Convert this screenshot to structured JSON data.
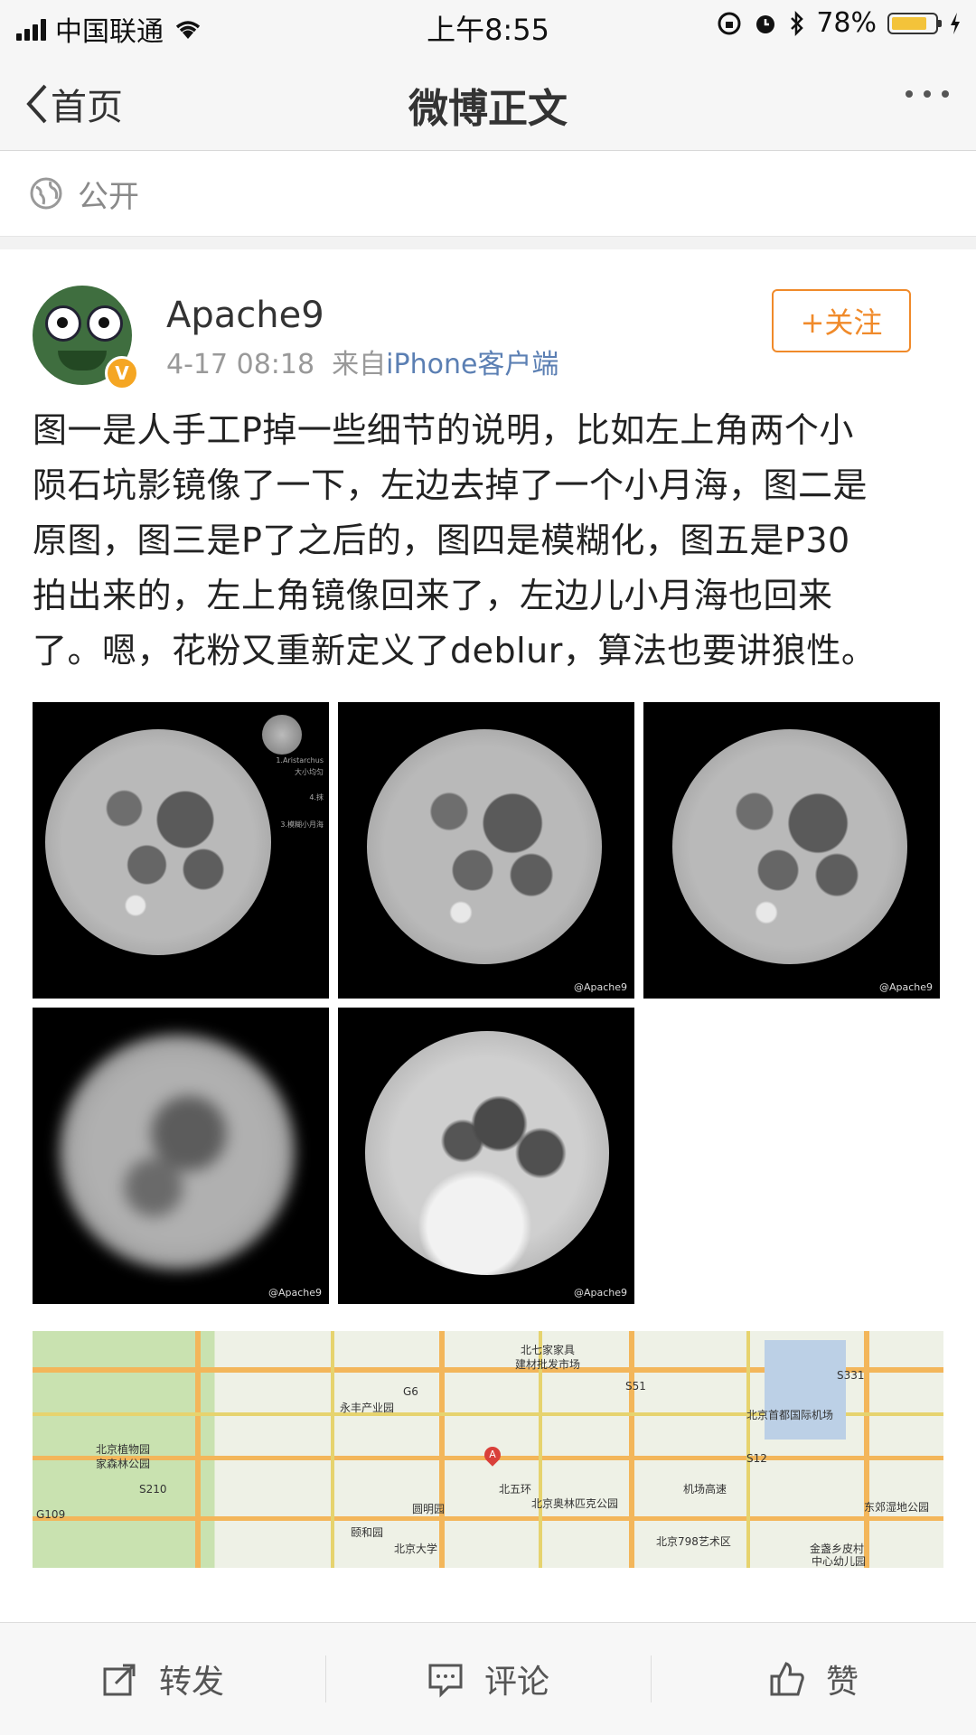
{
  "status_bar": {
    "carrier": "中国联通",
    "time": "上午8:55",
    "battery": "78%"
  },
  "nav": {
    "back_label": "首页",
    "title": "微博正文"
  },
  "visibility": {
    "label": "公开",
    "icon": "globe-icon"
  },
  "post": {
    "username": "Apache9",
    "timestamp": "4-17 08:18",
    "source_prefix": "来自",
    "source": "iPhone客户端",
    "follow_label": "+关注",
    "text_lines": [
      "图一是人手工P掉一些细节的说明，比如左上角两个小",
      "陨石坑影镜像了一下，左边去掉了一个小月海，图二是",
      "原图，图三是P了之后的，图四是模糊化，图五是P30",
      "拍出来的，左上角镜像回来了，左边儿小月海也回来",
      "了。嗯，花粉又重新定义了deblur，算法也要讲狼性。"
    ],
    "images": [
      {
        "watermark": "",
        "notes": [
          "1.Aristarchus",
          "大小均匀",
          "4.抹",
          "3.模糊小月海"
        ]
      },
      {
        "watermark": "@Apache9"
      },
      {
        "watermark": "@Apache9"
      },
      {
        "watermark": "@Apache9"
      },
      {
        "watermark": "@Apache9"
      }
    ],
    "map_labels": {
      "l1": "北七家家具",
      "l2": "建材批发市场",
      "l3": "永丰产业园",
      "l4": "北京首都国际机场",
      "l5": "北京植物园",
      "l6": "家森林公园",
      "l7": "北五环",
      "l8": "北京奥林匹克公园",
      "l9": "圆明园",
      "l10": "颐和园",
      "l11": "北京大学",
      "l12": "北京798艺术区",
      "l13": "东郊湿地公园",
      "l14": "金盏乡皮村",
      "l15": "中心幼儿园",
      "l16": "机场高速",
      "l17": "S331",
      "l18": "S210",
      "l19": "G109",
      "l20": "G6",
      "l21": "S12",
      "l22": "S51",
      "pin": "A"
    }
  },
  "actions": {
    "repost": "转发",
    "comment": "评论",
    "like": "赞"
  }
}
